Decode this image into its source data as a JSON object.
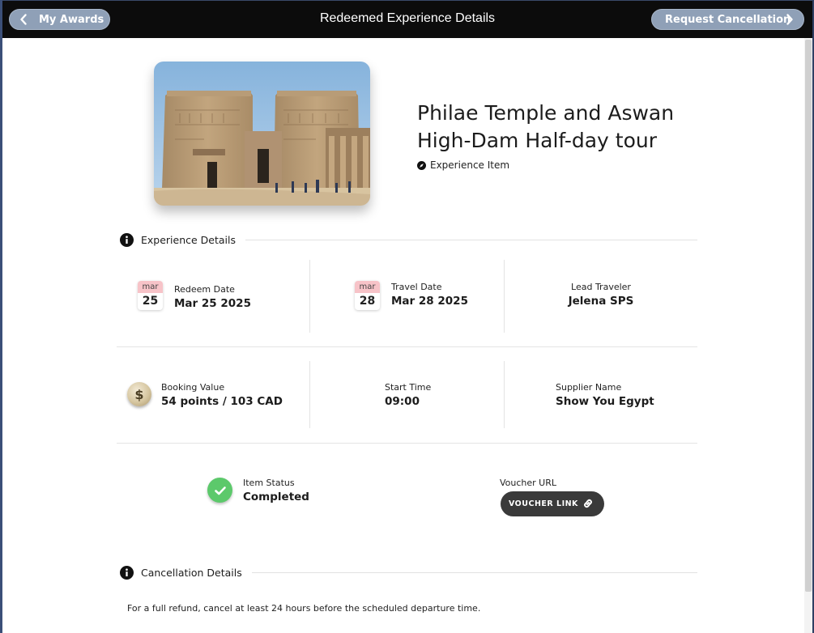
{
  "header": {
    "back_label": "My Awards",
    "title": "Redeemed Experience Details",
    "request_label": "Request Cancellation"
  },
  "experience": {
    "title_line1": "Philae Temple and Aswan",
    "title_line2": "High-Dam Half-day tour",
    "type_label": "Experience Item"
  },
  "details": {
    "section_label": "Experience Details",
    "redeem": {
      "month": "mar",
      "day": "25",
      "label": "Redeem Date",
      "value": "Mar 25 2025"
    },
    "travel": {
      "month": "mar",
      "day": "28",
      "label": "Travel Date",
      "value": "Mar 28 2025"
    },
    "lead": {
      "label": "Lead Traveler",
      "value": "Jelena SPS"
    },
    "booking": {
      "label": "Booking Value",
      "value": "54 points / 103 CAD"
    },
    "start": {
      "label": "Start Time",
      "value": "09:00"
    },
    "supplier": {
      "label": "Supplier Name",
      "value": "Show You Egypt"
    },
    "status": {
      "label": "Item Status",
      "value": "Completed"
    },
    "voucher": {
      "label": "Voucher URL",
      "button": "VOUCHER LINK"
    }
  },
  "cancellation": {
    "section_label": "Cancellation Details",
    "policy": "For a full refund, cancel at least 24 hours before the scheduled departure time."
  },
  "colors": {
    "topbar": "#0c0c0c",
    "pill": "#8fa0b7",
    "calendar_month": "#f7c3c8",
    "status_green": "#5cc96b",
    "voucher_button": "#3a3a3a"
  }
}
